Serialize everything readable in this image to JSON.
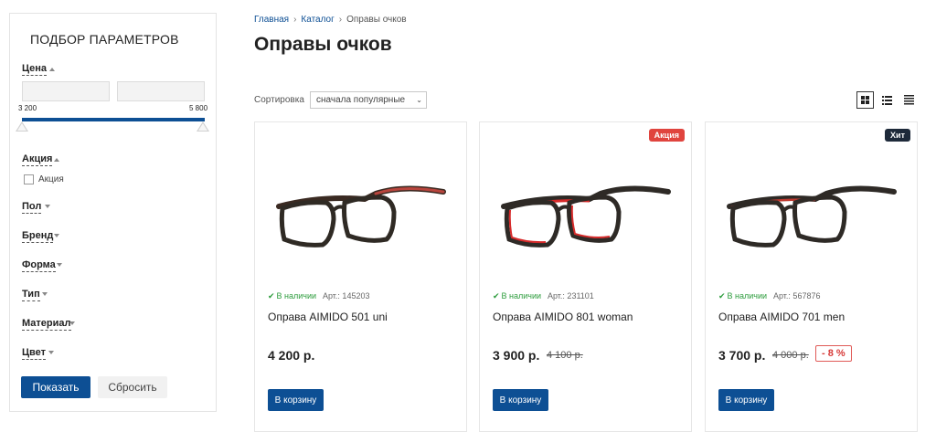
{
  "filter": {
    "title": "ПОДБОР ПАРАМЕТРОВ",
    "price": {
      "label": "Цена",
      "min_value": "",
      "max_value": "",
      "range_min": "3 200",
      "range_max": "5 800"
    },
    "sale": {
      "label": "Акция",
      "checkbox_label": "Акция"
    },
    "groups": [
      "Пол",
      "Бренд",
      "Форма",
      "Тип",
      "Материал",
      "Цвет"
    ],
    "show_label": "Показать",
    "reset_label": "Сбросить"
  },
  "breadcrumb": [
    "Главная",
    "Каталог",
    "Оправы очков"
  ],
  "page_title": "Оправы очков",
  "sort": {
    "label": "Сортировка",
    "value": "сначала популярные"
  },
  "view_modes": [
    "grid-view-icon",
    "list-view-icon",
    "compact-list-icon"
  ],
  "products": [
    {
      "badge": "",
      "availability": "В наличии",
      "article": "Арт.: 145203",
      "name": "Оправа AIMIDO 501 uni",
      "price": "4 200 р.",
      "old_price": "",
      "discount": "",
      "cart_label": "В корзину",
      "accent": "#b8453d"
    },
    {
      "badge": "Акция",
      "availability": "В наличии",
      "article": "Арт.: 231101",
      "name": "Оправа AIMIDO 801 woman",
      "price": "3 900 р.",
      "old_price": "4 100 р.",
      "discount": "",
      "cart_label": "В корзину",
      "accent": "#d62a2a"
    },
    {
      "badge": "Хит",
      "availability": "В наличии",
      "article": "Арт.: 567876",
      "name": "Оправа AIMIDO 701 men",
      "price": "3 700 р.",
      "old_price": "4 000 р.",
      "discount": "- 8 %",
      "cart_label": "В корзину",
      "accent": "#c03a30"
    }
  ],
  "colors": {
    "brand": "#0d4f94",
    "in_stock": "#2e9d3e",
    "sale_badge": "#e0443e",
    "hit_badge": "#1e2a3a"
  }
}
